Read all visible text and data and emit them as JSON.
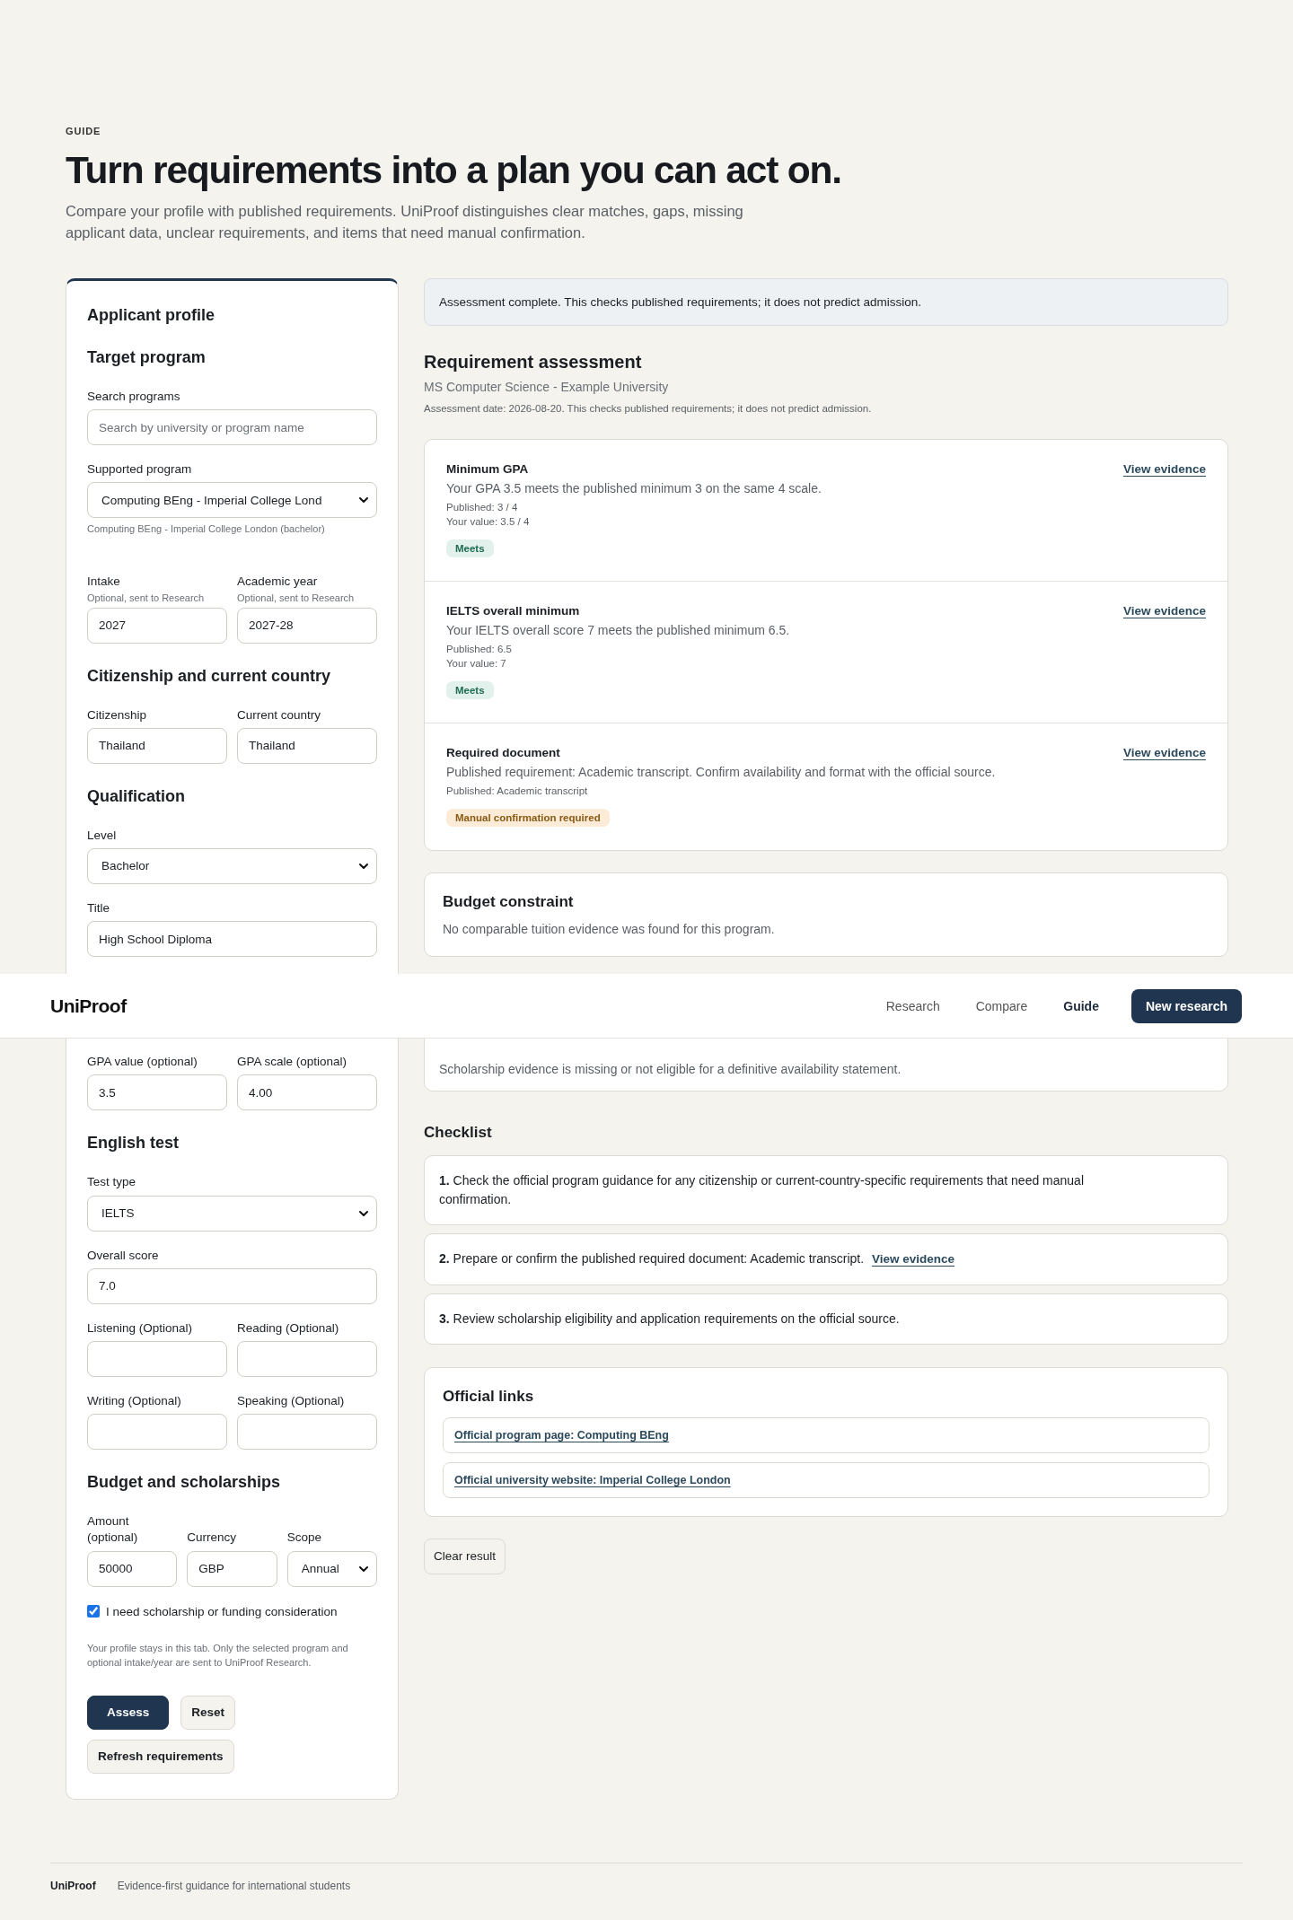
{
  "header": {
    "logo": "UniProof",
    "nav": [
      {
        "label": "Research",
        "selected": false
      },
      {
        "label": "Compare",
        "selected": false
      },
      {
        "label": "Guide",
        "selected": true
      }
    ],
    "action": "New research"
  },
  "intro": {
    "eyebrow": "GUIDE",
    "title": "Turn requirements into a plan you can act on.",
    "description": "Compare your profile with published requirements. UniProof distinguishes clear matches, gaps, missing applicant data, unclear requirements, and items that need manual confirmation."
  },
  "profile": {
    "title": "Applicant profile",
    "sections": [
      {
        "heading": "Target program",
        "rows": [
          [
            {
              "kind": "input",
              "label": "Search programs",
              "placeholder": "Search by university or program name"
            }
          ],
          [
            {
              "kind": "select",
              "label": "Supported program",
              "value": "Computing BEng - Imperial College Lond",
              "help": "Computing BEng - Imperial College London (bachelor)"
            }
          ],
          [
            {
              "kind": "input",
              "label": "Intake",
              "hint": "Optional, sent to Research",
              "value": "2027"
            },
            {
              "kind": "input",
              "label": "Academic year",
              "hint": "Optional, sent to Research",
              "value": "2027-28"
            }
          ]
        ]
      },
      {
        "heading": "Citizenship and current country",
        "rows": [
          [
            {
              "kind": "input",
              "label": "Citizenship",
              "value": "Thailand"
            },
            {
              "kind": "input",
              "label": "Current country",
              "value": "Thailand"
            }
          ]
        ]
      },
      {
        "heading": "Qualification",
        "rows": [
          [
            {
              "kind": "select",
              "label": "Level",
              "value": "Bachelor"
            }
          ],
          [
            {
              "kind": "input",
              "label": "Title",
              "value": "High School Diploma"
            }
          ],
          [
            {
              "kind": "input",
              "label": "GPA value (optional)",
              "value": "3.5"
            },
            {
              "kind": "input",
              "label": "GPA scale (optional)",
              "value": "4.00"
            }
          ]
        ]
      },
      {
        "heading": "English test",
        "rows": [
          [
            {
              "kind": "select",
              "label": "Test type",
              "value": "IELTS"
            }
          ],
          [
            {
              "kind": "input",
              "label": "Overall score",
              "value": "7.0"
            }
          ],
          [
            {
              "kind": "input",
              "label": "Listening (Optional)"
            },
            {
              "kind": "input",
              "label": "Reading (Optional)"
            }
          ],
          [
            {
              "kind": "input",
              "label": "Writing (Optional)"
            },
            {
              "kind": "input",
              "label": "Speaking (Optional)"
            }
          ]
        ]
      },
      {
        "heading": "Budget and scholarships",
        "rows": [
          [
            {
              "kind": "input",
              "label": "Amount (optional)",
              "value": "50000"
            },
            {
              "kind": "input",
              "label": "Currency",
              "value": "GBP"
            },
            {
              "kind": "select",
              "label": "Scope",
              "value": "Annual"
            }
          ],
          [
            {
              "kind": "checkbox",
              "label": "I need scholarship or funding consideration",
              "checked": true
            }
          ]
        ]
      }
    ],
    "note": "Your profile stays in this tab. Only the selected program and optional intake/year are sent to UniProof Research.",
    "buttons": [
      {
        "label": "Assess",
        "kind": "primary"
      },
      {
        "label": "Reset",
        "kind": "secondary"
      },
      {
        "label": "Refresh requirements",
        "kind": "secondary"
      }
    ]
  },
  "notice": "Assessment complete. This checks published requirements; it does not predict admission.",
  "assessment": {
    "title": "Requirement assessment",
    "subtitle": "MS Computer Science - Example University",
    "date_note": "Assessment date: 2026-08-20. This checks published requirements; it does not predict admission.",
    "requirements": [
      {
        "title": "Minimum GPA",
        "summary": "Your GPA 3.5 meets the published minimum 3 on the same 4 scale.",
        "details": [
          "Published: 3 / 4",
          "Your value: 3.5 / 4"
        ],
        "status": {
          "label": "Meets",
          "kind": "meets"
        },
        "link": "View evidence"
      },
      {
        "title": "IELTS overall minimum",
        "summary": "Your IELTS overall score 7 meets the published minimum 6.5.",
        "details": [
          "Published: 6.5",
          "Your value: 7"
        ],
        "status": {
          "label": "Meets",
          "kind": "meets"
        },
        "link": "View evidence"
      },
      {
        "title": "Required document",
        "summary": "Published requirement: Academic transcript. Confirm availability and format with the official source.",
        "details": [
          "Published: Academic transcript"
        ],
        "status": {
          "label": "Manual confirmation required",
          "kind": "manual"
        },
        "link": "View evidence"
      }
    ]
  },
  "budget": {
    "title": "Budget constraint",
    "text": "No comparable tuition evidence was found for this program."
  },
  "scholarship": {
    "text": "Scholarship evidence is missing or not eligible for a definitive availability statement."
  },
  "checklist": {
    "title": "Checklist",
    "items": [
      {
        "number": "1.",
        "text": "Check the official program guidance for any citizenship or current-country-specific requirements that need manual confirmation."
      },
      {
        "number": "2.",
        "text": "Prepare or confirm the published required document: Academic transcript.",
        "link": "View evidence"
      },
      {
        "number": "3.",
        "text": "Review scholarship eligibility and application requirements on the official source."
      }
    ]
  },
  "official_links": {
    "title": "Official links",
    "links": [
      "Official program page: Computing BEng",
      "Official university website: Imperial College London"
    ]
  },
  "clear_button": "Clear result",
  "footer": {
    "brand": "UniProof",
    "tagline": "Evidence-first guidance for international students"
  }
}
